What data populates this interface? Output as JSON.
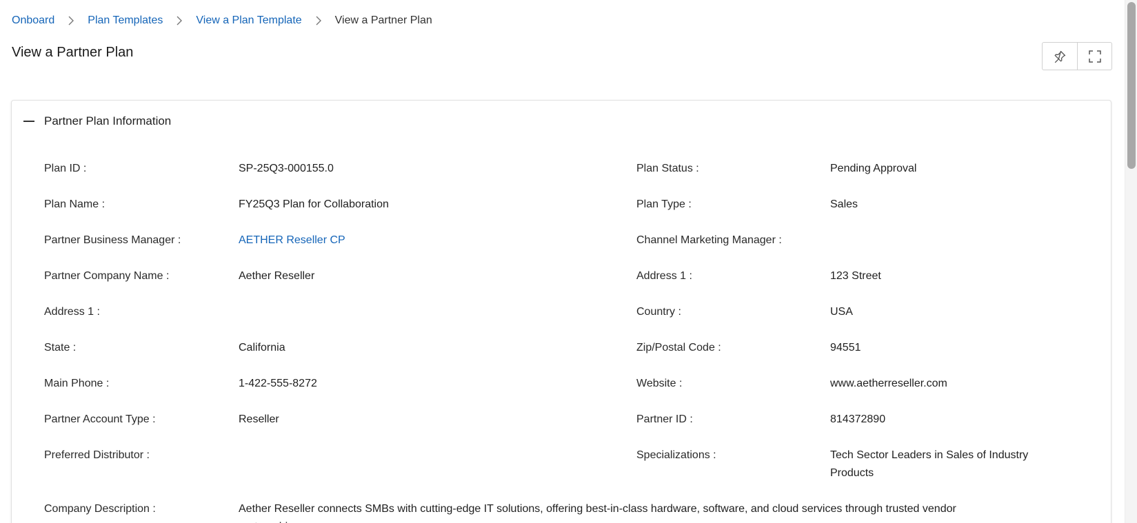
{
  "breadcrumb": {
    "items": [
      "Onboard",
      "Plan Templates",
      "View a Plan Template"
    ],
    "current": "View a Partner Plan"
  },
  "page_title": "View a Partner Plan",
  "toolbar": {
    "pin_icon": "pin-icon",
    "fullscreen_icon": "fullscreen-icon"
  },
  "section": {
    "title": "Partner Plan Information",
    "collapse_icon": "minus-icon"
  },
  "fields": {
    "plan_id": {
      "label": "Plan ID :",
      "value": "SP-25Q3-000155.0"
    },
    "plan_status": {
      "label": "Plan Status :",
      "value": "Pending Approval"
    },
    "plan_name": {
      "label": "Plan Name :",
      "value": "FY25Q3 Plan for Collaboration"
    },
    "plan_type": {
      "label": "Plan Type :",
      "value": "Sales"
    },
    "partner_business_manager": {
      "label": "Partner Business Manager :",
      "value": "AETHER Reseller CP"
    },
    "channel_marketing_manager": {
      "label": "Channel Marketing Manager :",
      "value": ""
    },
    "partner_company_name": {
      "label": "Partner Company Name :",
      "value": "Aether Reseller"
    },
    "address_1_right": {
      "label": "Address 1 :",
      "value": "123 Street"
    },
    "address_1_left": {
      "label": "Address 1 :",
      "value": ""
    },
    "country": {
      "label": "Country :",
      "value": "USA"
    },
    "state": {
      "label": "State :",
      "value": "California"
    },
    "zip": {
      "label": "Zip/Postal Code :",
      "value": "94551"
    },
    "main_phone": {
      "label": "Main Phone :",
      "value": "1-422-555-8272"
    },
    "website": {
      "label": "Website :",
      "value": "www.aetherreseller.com"
    },
    "partner_account_type": {
      "label": "Partner Account Type :",
      "value": "Reseller"
    },
    "partner_id": {
      "label": "Partner ID :",
      "value": "814372890"
    },
    "preferred_distributor": {
      "label": "Preferred Distributor :",
      "value": ""
    },
    "specializations": {
      "label": "Specializations :",
      "value": "Tech Sector Leaders in Sales of Industry Products"
    },
    "company_description": {
      "label": "Company Description :",
      "value": "Aether Reseller connects SMBs with cutting-edge IT solutions, offering best-in-class hardware, software, and cloud services through trusted vendor partnerships."
    }
  },
  "colors": {
    "link": "#1565b8",
    "text": "#1f1f1f",
    "border": "#d0d0d0"
  }
}
